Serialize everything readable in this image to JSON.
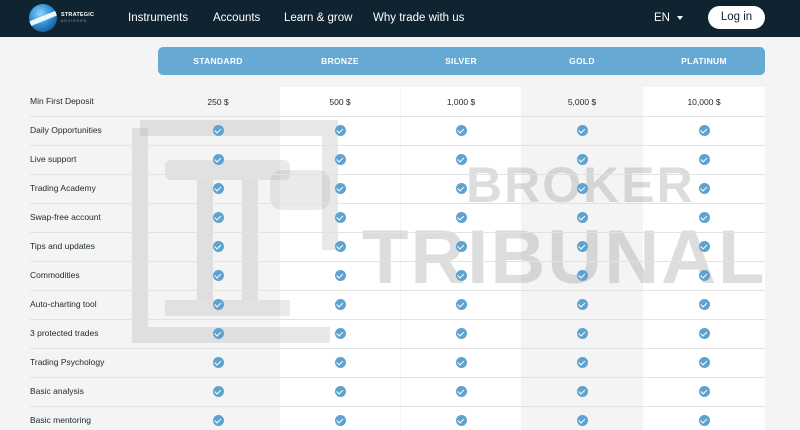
{
  "header": {
    "logo_line1": "STRATEGIC",
    "logo_line2": "ADVISORS",
    "nav_items": [
      "Instruments",
      "Accounts",
      "Learn & grow",
      "Why trade with us"
    ],
    "language": "EN",
    "login_label": "Log in"
  },
  "tiers": [
    "STANDARD",
    "BRONZE",
    "SILVER",
    "GOLD",
    "PLATINUM"
  ],
  "rows": [
    {
      "label": "Min First Deposit",
      "values": [
        "250 $",
        "500 $",
        "1,000 $",
        "5,000 $",
        "10,000 $"
      ]
    },
    {
      "label": "Daily Opportunities",
      "checks": [
        true,
        true,
        true,
        true,
        true
      ]
    },
    {
      "label": "Live support",
      "checks": [
        true,
        true,
        true,
        true,
        true
      ]
    },
    {
      "label": "Trading Academy",
      "checks": [
        true,
        true,
        true,
        true,
        true
      ]
    },
    {
      "label": "Swap-free account",
      "checks": [
        true,
        true,
        true,
        true,
        true
      ]
    },
    {
      "label": "Tips and updates",
      "checks": [
        true,
        true,
        true,
        true,
        true
      ]
    },
    {
      "label": "Commodities",
      "checks": [
        true,
        true,
        true,
        true,
        true
      ]
    },
    {
      "label": "Auto-charting tool",
      "checks": [
        true,
        true,
        true,
        true,
        true
      ]
    },
    {
      "label": "3 protected trades",
      "checks": [
        true,
        true,
        true,
        true,
        true
      ]
    },
    {
      "label": "Trading Psychology",
      "checks": [
        true,
        true,
        true,
        true,
        true
      ]
    },
    {
      "label": "Basic analysis",
      "checks": [
        true,
        true,
        true,
        true,
        true
      ]
    },
    {
      "label": "Basic mentoring",
      "checks": [
        true,
        true,
        true,
        true,
        true
      ]
    }
  ],
  "watermark": {
    "line1": "BROKER",
    "line2": "TRIBUNAL"
  },
  "colors": {
    "navbar": "#0f2330",
    "tier_bar": "#66a9d3",
    "check": "#5ea3cf"
  },
  "icons": {
    "check": "check-circle-icon",
    "caret": "chevron-down-icon",
    "logo": "globe-logo-icon"
  }
}
